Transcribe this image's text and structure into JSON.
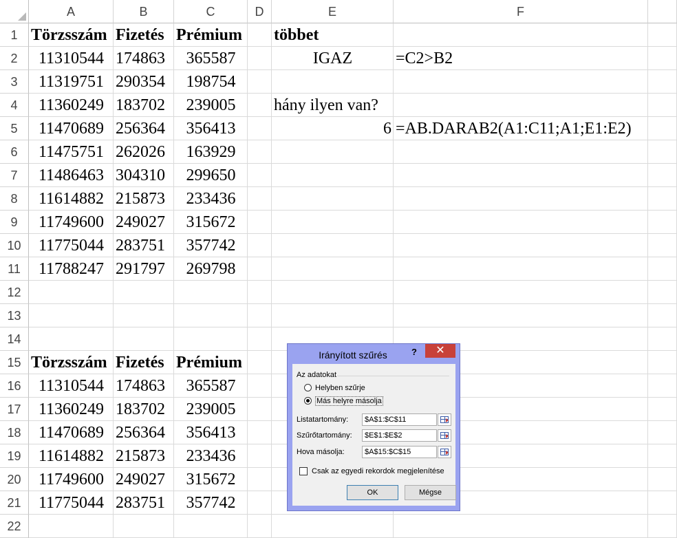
{
  "columns": [
    "A",
    "B",
    "C",
    "D",
    "E",
    "F"
  ],
  "rows": [
    "1",
    "2",
    "3",
    "4",
    "5",
    "6",
    "7",
    "8",
    "9",
    "10",
    "11",
    "12",
    "13",
    "14",
    "15",
    "16",
    "17",
    "18",
    "19",
    "20",
    "21",
    "22"
  ],
  "table1": {
    "headers": [
      "Törzsszám",
      "Fizetés",
      "Prémium"
    ],
    "rows": [
      [
        "11310544",
        "174863",
        "365587"
      ],
      [
        "11319751",
        "290354",
        "198754"
      ],
      [
        "11360249",
        "183702",
        "239005"
      ],
      [
        "11470689",
        "256364",
        "356413"
      ],
      [
        "11475751",
        "262026",
        "163929"
      ],
      [
        "11486463",
        "304310",
        "299650"
      ],
      [
        "11614882",
        "215873",
        "233436"
      ],
      [
        "11749600",
        "249027",
        "315672"
      ],
      [
        "11775044",
        "283751",
        "357742"
      ],
      [
        "11788247",
        "291797",
        "269798"
      ]
    ]
  },
  "criteria": {
    "e1": "többet",
    "e2": "IGAZ",
    "f2": "=C2>B2",
    "e4": "hány ilyen van?",
    "e5": "6",
    "f5": "=AB.DARAB2(A1:C11;A1;E1:E2)"
  },
  "table2": {
    "headers": [
      "Törzsszám",
      "Fizetés",
      "Prémium"
    ],
    "rows": [
      [
        "11310544",
        "174863",
        "365587"
      ],
      [
        "11360249",
        "183702",
        "239005"
      ],
      [
        "11470689",
        "256364",
        "356413"
      ],
      [
        "11614882",
        "215873",
        "233436"
      ],
      [
        "11749600",
        "249027",
        "315672"
      ],
      [
        "11775044",
        "283751",
        "357742"
      ]
    ]
  },
  "dialog": {
    "title": "Irányított szűrés",
    "help": "?",
    "close": "✕",
    "group_label": "Az adatokat",
    "radio_in_place": "Helyben szűrje",
    "radio_copy": "Más helyre másolja",
    "list_range_label": "Listatartomány:",
    "list_range_value": "$A$1:$C$11",
    "criteria_range_label": "Szűrőtartomány:",
    "criteria_range_value": "$E$1:$E$2",
    "copy_to_label": "Hova másolja:",
    "copy_to_value": "$A$15:$C$15",
    "unique_label": "Csak az egyedi rekordok megjelenítése",
    "ok": "OK",
    "cancel": "Mégse"
  }
}
